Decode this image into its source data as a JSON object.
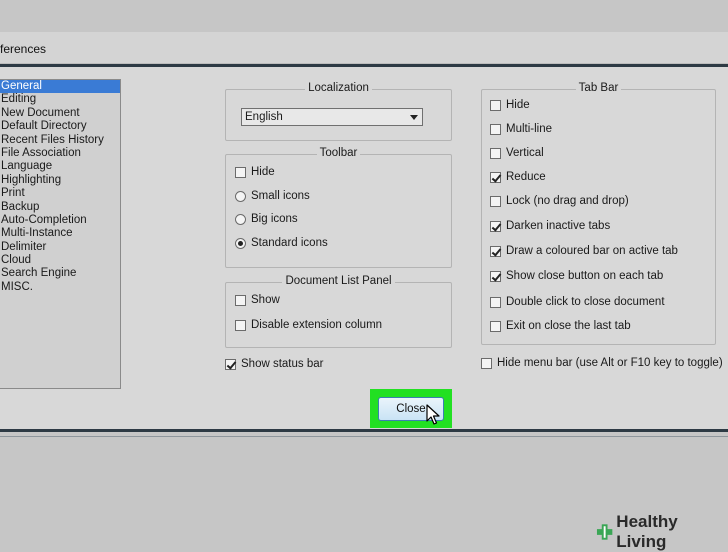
{
  "window": {
    "title": "ferences"
  },
  "sidebar": {
    "items": [
      "General",
      "Editing",
      "New Document",
      "Default Directory",
      "Recent Files History",
      "File Association",
      "Language",
      "Highlighting",
      "Print",
      "Backup",
      "Auto-Completion",
      "Multi-Instance",
      "Delimiter",
      "Cloud",
      "Search Engine",
      "MISC."
    ],
    "selected": "General"
  },
  "localization": {
    "title": "Localization",
    "value": "English"
  },
  "toolbar": {
    "title": "Toolbar",
    "hide": "Hide",
    "small_icons": "Small icons",
    "big_icons": "Big icons",
    "standard_icons": "Standard icons",
    "selected": "Standard icons"
  },
  "doc_list": {
    "title": "Document List Panel",
    "show": "Show",
    "disable_ext": "Disable extension column"
  },
  "status_bar": {
    "label": "Show status bar",
    "checked": true
  },
  "tab_bar": {
    "title": "Tab Bar",
    "items": [
      {
        "label": "Hide",
        "checked": false
      },
      {
        "label": "Multi-line",
        "checked": false
      },
      {
        "label": "Vertical",
        "checked": false
      },
      {
        "label": "Reduce",
        "checked": true
      },
      {
        "label": "Lock (no drag and drop)",
        "checked": false
      },
      {
        "label": "Darken inactive tabs",
        "checked": true
      },
      {
        "label": "Draw a coloured bar on active tab",
        "checked": true
      },
      {
        "label": "Show close button on each tab",
        "checked": true
      },
      {
        "label": "Double click to close document",
        "checked": false
      },
      {
        "label": "Exit on close the last tab",
        "checked": false
      }
    ]
  },
  "menu_bar": {
    "label": "Hide menu bar (use Alt or F10 key to toggle)",
    "checked": false
  },
  "buttons": {
    "close": "Close"
  },
  "watermark": {
    "text": "Healthy Living"
  },
  "colors": {
    "selection": "#3a7bd5",
    "highlight": "#22e022",
    "button_border": "#3c7fb1"
  }
}
